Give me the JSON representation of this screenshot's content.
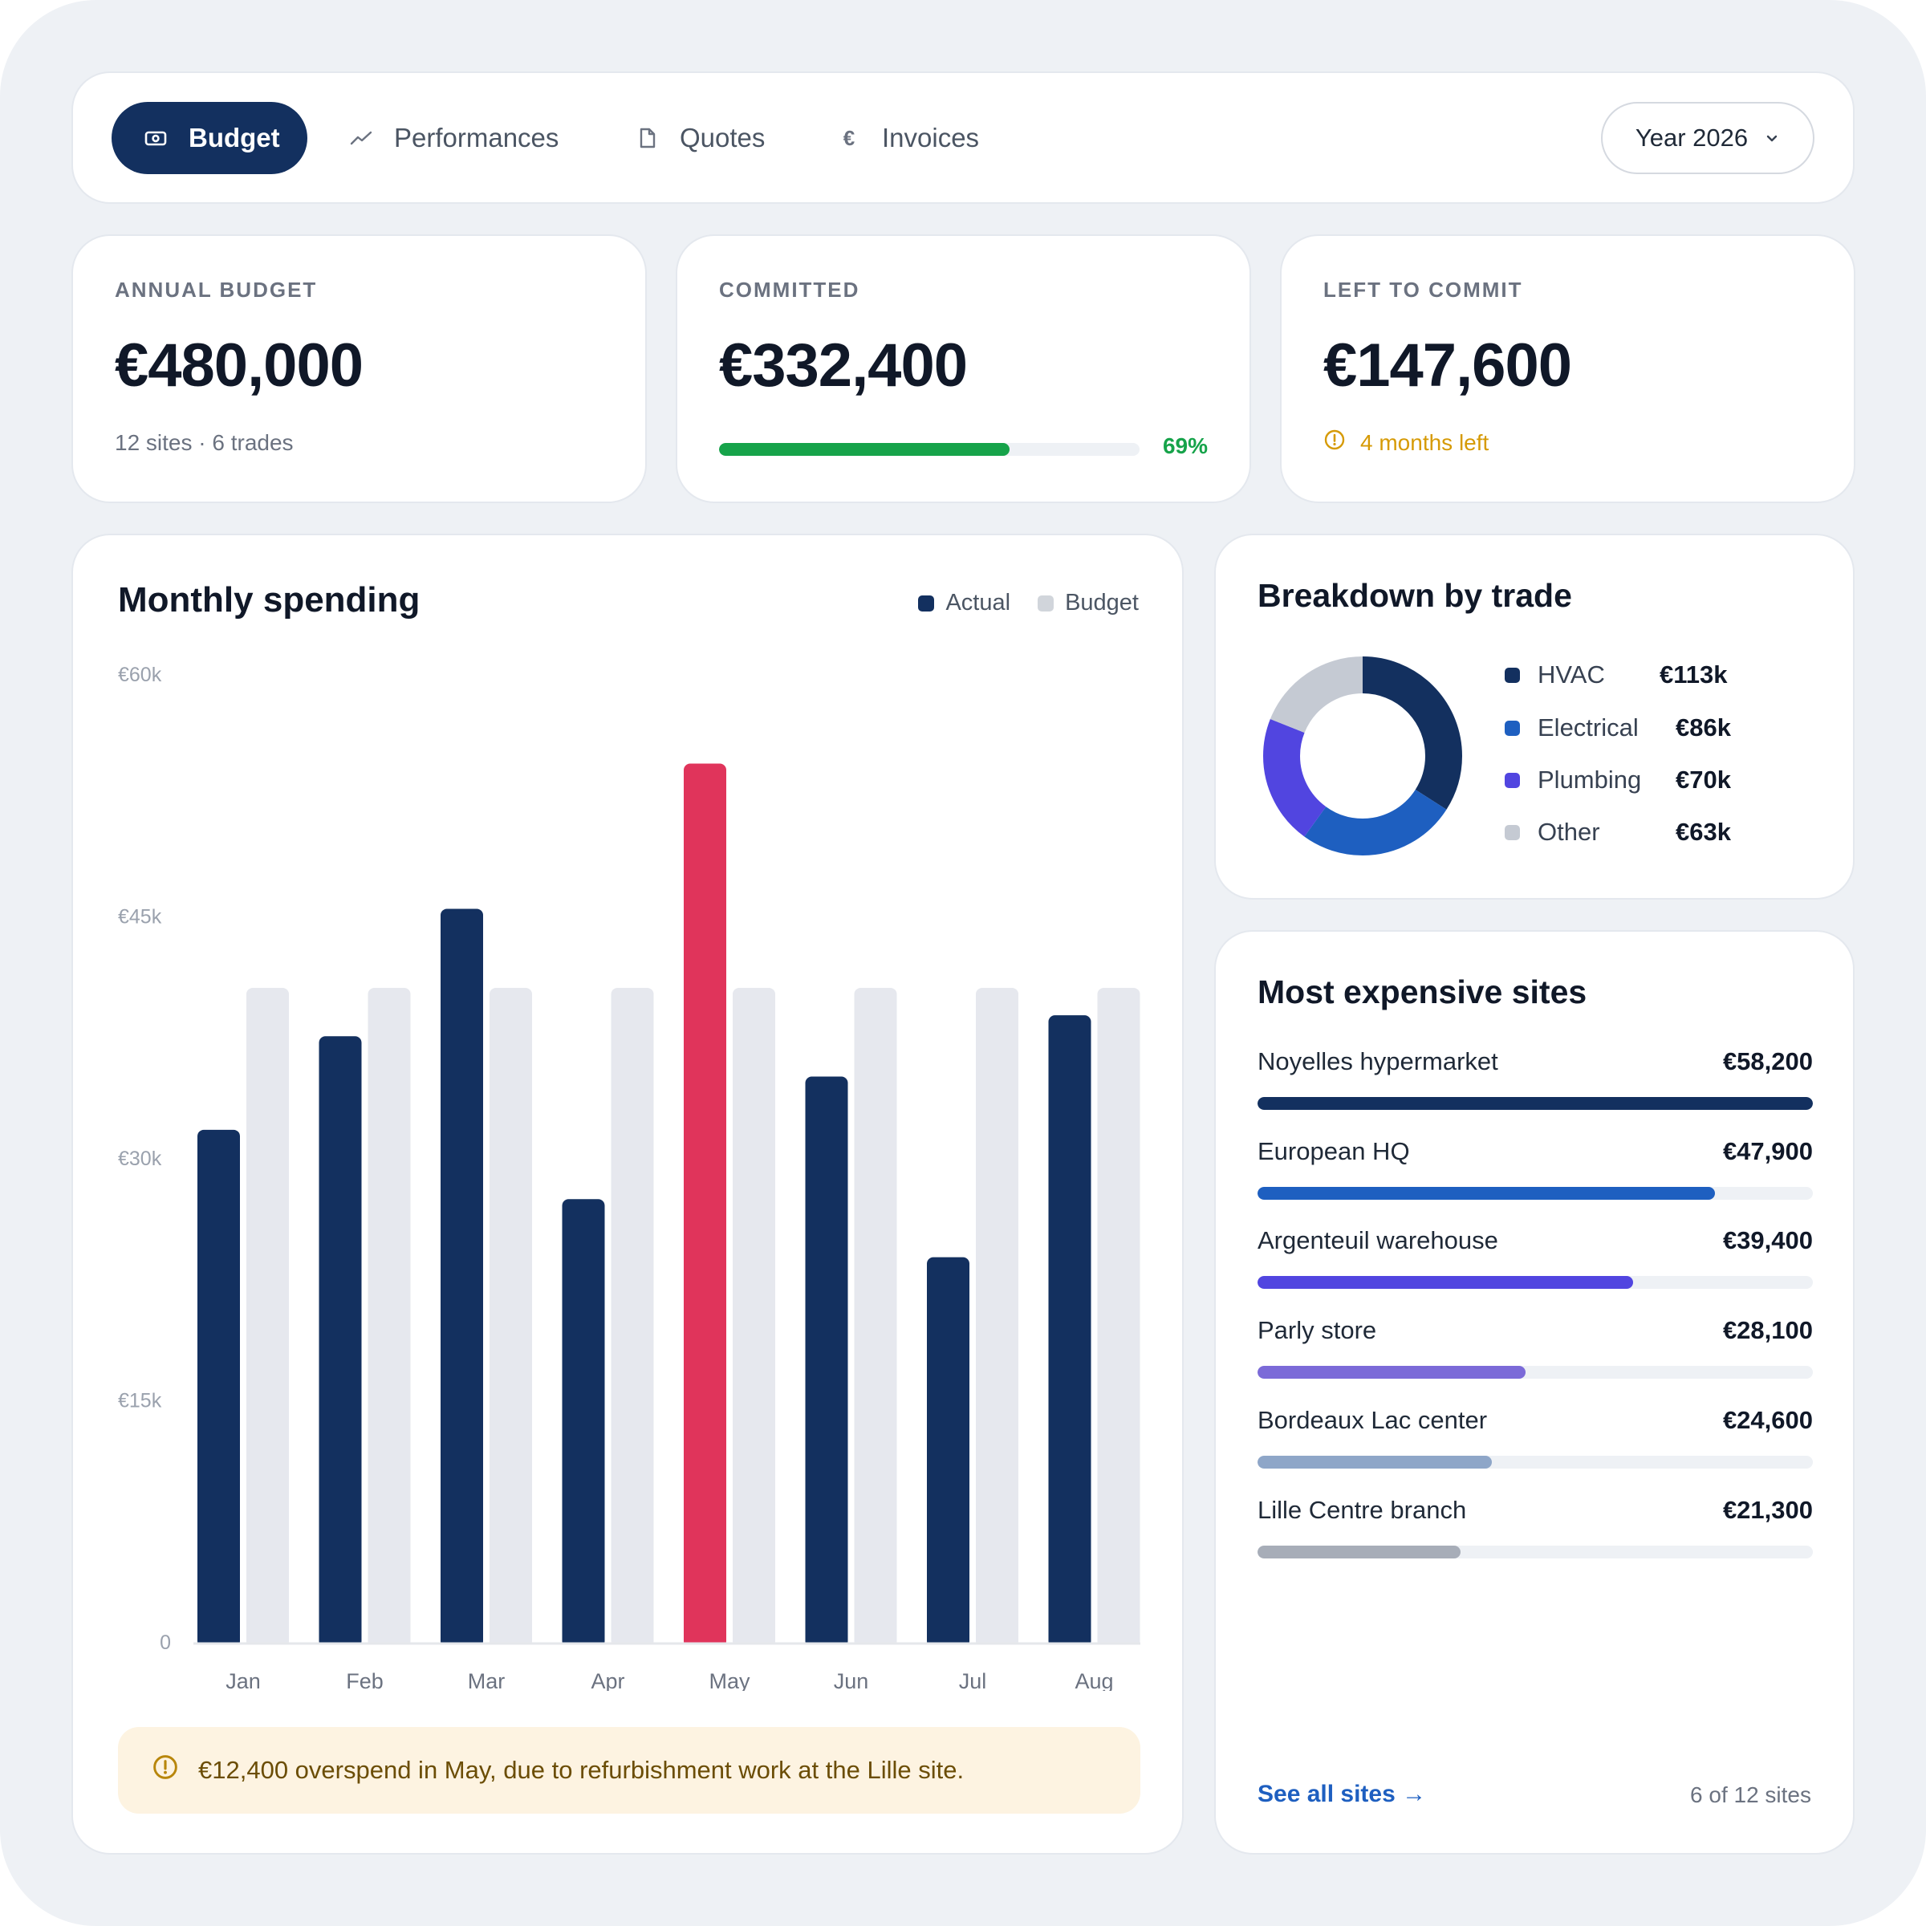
{
  "nav": {
    "tabs": [
      {
        "label": "Budget",
        "icon": "banknote-icon",
        "active": true
      },
      {
        "label": "Performances",
        "icon": "trend-icon",
        "active": false
      },
      {
        "label": "Quotes",
        "icon": "document-icon",
        "active": false
      },
      {
        "label": "Invoices",
        "icon": "euro-icon",
        "active": false
      }
    ],
    "year_label": "Year 2026"
  },
  "kpis": {
    "annual": {
      "label": "ANNUAL BUDGET",
      "value": "€480,000",
      "sub": "12 sites · 6 trades"
    },
    "committed": {
      "label": "COMMITTED",
      "value": "€332,400",
      "percent_label": "69%",
      "progress": 0.69
    },
    "left": {
      "label": "LEFT TO COMMIT",
      "value": "€147,600",
      "note": "4 months left"
    }
  },
  "colors": {
    "navy": "#13305f",
    "budget_bar": "#e6e8ee",
    "overspend": "#e0345b",
    "green": "#16a34a",
    "warning": "#d69a05",
    "link": "#1e5fc0"
  },
  "chart_data": {
    "type": "bar",
    "title": "Monthly spending",
    "categories": [
      "Jan",
      "Feb",
      "Mar",
      "Apr",
      "May",
      "Jun",
      "Jul",
      "Aug"
    ],
    "series": [
      {
        "name": "Actual",
        "values": [
          31800,
          37600,
          45500,
          27500,
          54500,
          35100,
          23900,
          38900
        ]
      },
      {
        "name": "Budget",
        "values": [
          40600,
          40600,
          40600,
          40600,
          40600,
          40600,
          40600,
          40600
        ]
      }
    ],
    "highlight": {
      "category": "May",
      "color": "#e0345b"
    },
    "ylim": [
      0,
      60000
    ],
    "yticks": [
      {
        "value": 0,
        "label": "0"
      },
      {
        "value": 15000,
        "label": "€15k"
      },
      {
        "value": 30000,
        "label": "€30k"
      },
      {
        "value": 45000,
        "label": "€45k"
      },
      {
        "value": 60000,
        "label": "€60k"
      }
    ],
    "legend": "top-right",
    "grid": false
  },
  "alert": {
    "text": "€12,400 overspend in May, due to refurbishment work at the Lille site."
  },
  "breakdown": {
    "title": "Breakdown by trade",
    "items": [
      {
        "name": "HVAC",
        "amount": "€113k",
        "value": 113,
        "color": "#13305f"
      },
      {
        "name": "Electrical",
        "amount": "€86k",
        "value": 86,
        "color": "#1e5fc0"
      },
      {
        "name": "Plumbing",
        "amount": "€70k",
        "value": 70,
        "color": "#5145e0"
      },
      {
        "name": "Other",
        "amount": "€63k",
        "value": 63,
        "color": "#c5cad3"
      }
    ]
  },
  "sites": {
    "title": "Most expensive sites",
    "max": 58200,
    "items": [
      {
        "name": "Noyelles hypermarket",
        "amount": "€58,200",
        "value": 58200,
        "color": "#13305f"
      },
      {
        "name": "European HQ",
        "amount": "€47,900",
        "value": 47900,
        "color": "#1e5fc0"
      },
      {
        "name": "Argenteuil warehouse",
        "amount": "€39,400",
        "value": 39400,
        "color": "#5145e0"
      },
      {
        "name": "Parly store",
        "amount": "€28,100",
        "value": 28100,
        "color": "#7b6ad8"
      },
      {
        "name": "Bordeaux Lac center",
        "amount": "€24,600",
        "value": 24600,
        "color": "#8ea6c8"
      },
      {
        "name": "Lille Centre branch",
        "amount": "€21,300",
        "value": 21300,
        "color": "#a7adb8"
      }
    ],
    "see_all": "See all sites →",
    "count": "6 of 12 sites"
  }
}
